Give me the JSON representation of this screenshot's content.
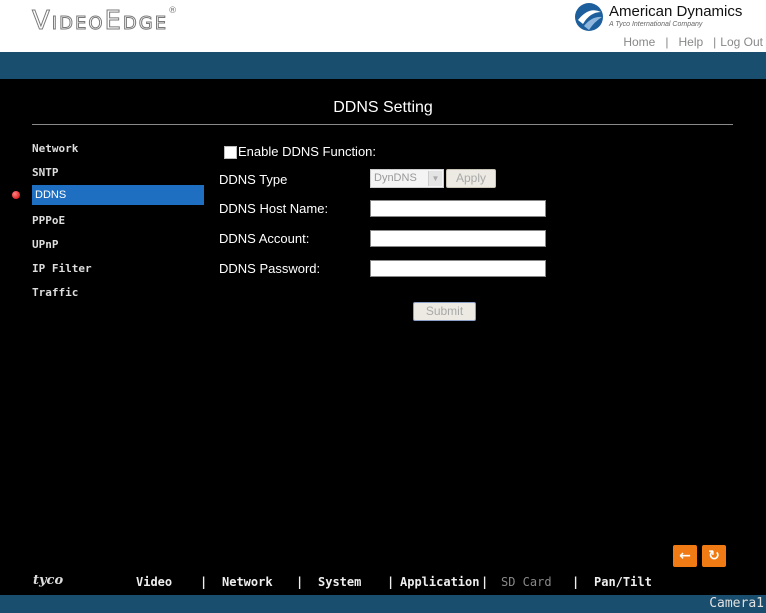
{
  "header": {
    "logo_text": "VideoEdge",
    "logo_reg": "®",
    "brand_name": "American Dynamics",
    "brand_tagline": "A Tyco International Company",
    "links": {
      "home": "Home",
      "sep1": "|",
      "help": "Help",
      "sep2": "|",
      "logout": "Log Out"
    }
  },
  "page": {
    "title": "DDNS Setting"
  },
  "sidebar": {
    "items": [
      {
        "label": "Network"
      },
      {
        "label": "SNTP"
      },
      {
        "label": "DDNS",
        "active": true
      },
      {
        "label": "PPPoE"
      },
      {
        "label": "UPnP"
      },
      {
        "label": "IP Filter"
      },
      {
        "label": "Traffic"
      }
    ]
  },
  "form": {
    "enable_label": "Enable DDNS Function:",
    "enable_checked": false,
    "type_label": "DDNS Type",
    "type_value": "DynDNS",
    "apply_label": "Apply",
    "host_label": "DDNS Host Name:",
    "host_value": "",
    "account_label": "DDNS Account:",
    "account_value": "",
    "password_label": "DDNS Password:",
    "password_value": "",
    "submit_label": "Submit"
  },
  "icons": {
    "back": "arrow-left-icon",
    "refresh": "refresh-icon",
    "back_glyph": "←",
    "refresh_glyph": "↻"
  },
  "bottom_nav": {
    "brand": "tyco",
    "items": [
      {
        "label": "Video"
      },
      {
        "label": "Network"
      },
      {
        "label": "System"
      },
      {
        "label": "Application"
      },
      {
        "label": "SD Card",
        "disabled": true
      },
      {
        "label": "Pan/Tilt"
      }
    ],
    "sep": "|"
  },
  "status": {
    "camera": "Camera1"
  },
  "colors": {
    "accent_blue": "#1e6fc2",
    "bar_blue": "#1a4e6e",
    "orange": "#f07a14",
    "active_dot": "#d00000"
  }
}
